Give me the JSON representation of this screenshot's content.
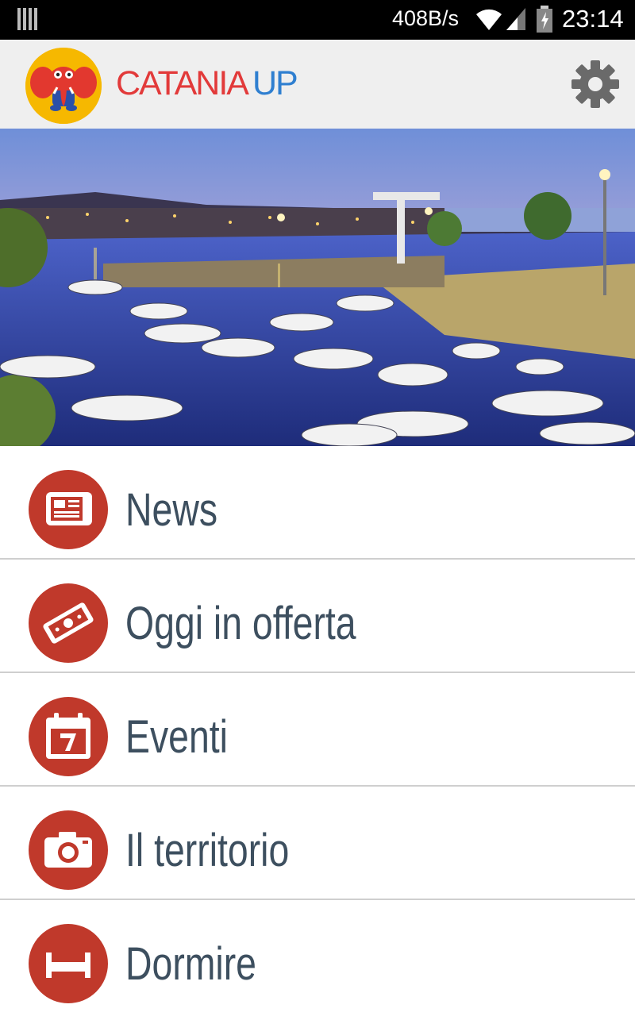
{
  "status_bar": {
    "network_speed": "408B/s",
    "time": "23:14",
    "icons": [
      "signal-bars-icon",
      "wifi-icon",
      "cell-signal-icon",
      "battery-icon"
    ]
  },
  "app_bar": {
    "title_part1": "CATANIA",
    "title_part2": "UP",
    "logo_icon": "elephant-logo-icon",
    "settings_icon": "gear-icon",
    "colors": {
      "title_part1": "#e23a3a",
      "title_part2": "#2f7fd0",
      "logo_bg": "#f6b800"
    }
  },
  "hero": {
    "image": "harbor-at-dusk-photo"
  },
  "menu": {
    "accent": "#c0392b",
    "label_color": "#3d4f5f",
    "items": [
      {
        "label": "News",
        "icon": "newspaper-icon"
      },
      {
        "label": "Oggi in offerta",
        "icon": "ticket-icon"
      },
      {
        "label": "Eventi",
        "icon": "calendar-icon"
      },
      {
        "label": "Il territorio",
        "icon": "camera-icon"
      },
      {
        "label": "Dormire",
        "icon": "bed-icon"
      }
    ]
  }
}
